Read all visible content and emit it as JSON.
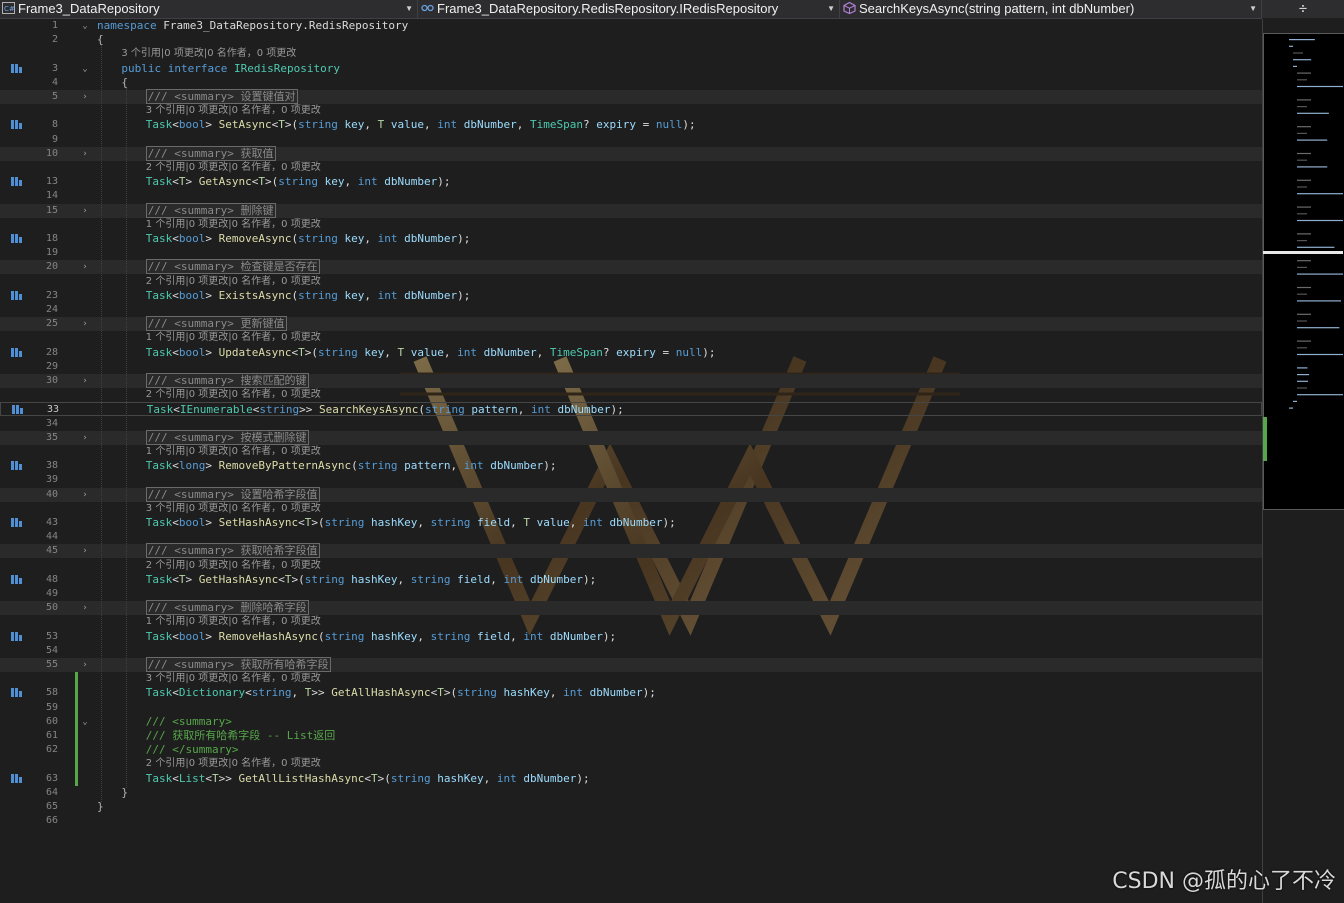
{
  "navbar": {
    "project": "Frame3_DataRepository",
    "type_path": "Frame3_DataRepository.RedisRepository.IRedisRepository",
    "member": "SearchKeysAsync(string pattern, int dbNumber)",
    "split_glyph": "÷"
  },
  "colors": {
    "keyword": "#569cd6",
    "type": "#4ec9b0",
    "method": "#dcdcaa",
    "parameter": "#9cdcfe",
    "comment": "#57a64a",
    "modified": "#57a64a"
  },
  "watermark_logo": "Wonder Woman W",
  "code": {
    "lines": [
      {
        "n": "1",
        "kind": "code",
        "fold": "⌄",
        "html": "<span class=\"kw\">namespace</span> Frame3_DataRepository.RedisRepository"
      },
      {
        "n": "2",
        "kind": "code",
        "html": "<span class=\"pu\">{</span>"
      },
      {
        "kind": "lens",
        "indent": 2,
        "text": "3 个引用|0 项更改|0 名作者，0 项更改"
      },
      {
        "n": "3",
        "kind": "code",
        "ref": true,
        "fold": "⌄",
        "indent": 2,
        "html": "<span class=\"kw\">public</span> <span class=\"kw\">interface</span> <span class=\"ty\">IRedisRepository</span>"
      },
      {
        "n": "4",
        "kind": "code",
        "indent": 2,
        "html": "<span class=\"pu\">{</span>"
      },
      {
        "n": "5",
        "kind": "summary",
        "fold": "›",
        "indent": 4,
        "text": "/// <summary> 设置键值对"
      },
      {
        "kind": "lens",
        "indent": 4,
        "text": "3 个引用|0 项更改|0 名作者，0 项更改"
      },
      {
        "n": "8",
        "kind": "code",
        "ref": true,
        "indent": 4,
        "html": "<span class=\"ty\">Task</span>&lt;<span class=\"kw\">bool</span>&gt; <span class=\"fn\">SetAsync</span>&lt;<span class=\"tp\">T</span>&gt;(<span class=\"kw\">string</span> <span class=\"pm\">key</span>, <span class=\"tp\">T</span> <span class=\"pm\">value</span>, <span class=\"kw\">int</span> <span class=\"pm\">dbNumber</span>, <span class=\"ty\">TimeSpan</span>? <span class=\"pm\">expiry</span> = <span class=\"kw\">null</span>);"
      },
      {
        "n": "9",
        "kind": "blank"
      },
      {
        "n": "10",
        "kind": "summary",
        "fold": "›",
        "indent": 4,
        "text": "/// <summary> 获取值"
      },
      {
        "kind": "lens",
        "indent": 4,
        "text": "2 个引用|0 项更改|0 名作者，0 项更改"
      },
      {
        "n": "13",
        "kind": "code",
        "ref": true,
        "indent": 4,
        "html": "<span class=\"ty\">Task</span>&lt;<span class=\"tp\">T</span>&gt; <span class=\"fn\">GetAsync</span>&lt;<span class=\"tp\">T</span>&gt;(<span class=\"kw\">string</span> <span class=\"pm\">key</span>, <span class=\"kw\">int</span> <span class=\"pm\">dbNumber</span>);"
      },
      {
        "n": "14",
        "kind": "blank"
      },
      {
        "n": "15",
        "kind": "summary",
        "fold": "›",
        "indent": 4,
        "text": "/// <summary> 删除键"
      },
      {
        "kind": "lens",
        "indent": 4,
        "text": "1 个引用|0 项更改|0 名作者，0 项更改"
      },
      {
        "n": "18",
        "kind": "code",
        "ref": true,
        "indent": 4,
        "html": "<span class=\"ty\">Task</span>&lt;<span class=\"kw\">bool</span>&gt; <span class=\"fn\">RemoveAsync</span>(<span class=\"kw\">string</span> <span class=\"pm\">key</span>, <span class=\"kw\">int</span> <span class=\"pm\">dbNumber</span>);"
      },
      {
        "n": "19",
        "kind": "blank"
      },
      {
        "n": "20",
        "kind": "summary",
        "fold": "›",
        "indent": 4,
        "text": "/// <summary> 检查键是否存在"
      },
      {
        "kind": "lens",
        "indent": 4,
        "text": "2 个引用|0 项更改|0 名作者，0 项更改"
      },
      {
        "n": "23",
        "kind": "code",
        "ref": true,
        "indent": 4,
        "html": "<span class=\"ty\">Task</span>&lt;<span class=\"kw\">bool</span>&gt; <span class=\"fn\">ExistsAsync</span>(<span class=\"kw\">string</span> <span class=\"pm\">key</span>, <span class=\"kw\">int</span> <span class=\"pm\">dbNumber</span>);"
      },
      {
        "n": "24",
        "kind": "blank"
      },
      {
        "n": "25",
        "kind": "summary",
        "fold": "›",
        "indent": 4,
        "text": "/// <summary> 更新键值"
      },
      {
        "kind": "lens",
        "indent": 4,
        "text": "1 个引用|0 项更改|0 名作者，0 项更改"
      },
      {
        "n": "28",
        "kind": "code",
        "ref": true,
        "indent": 4,
        "html": "<span class=\"ty\">Task</span>&lt;<span class=\"kw\">bool</span>&gt; <span class=\"fn\">UpdateAsync</span>&lt;<span class=\"tp\">T</span>&gt;(<span class=\"kw\">string</span> <span class=\"pm\">key</span>, <span class=\"tp\">T</span> <span class=\"pm\">value</span>, <span class=\"kw\">int</span> <span class=\"pm\">dbNumber</span>, <span class=\"ty\">TimeSpan</span>? <span class=\"pm\">expiry</span> = <span class=\"kw\">null</span>);"
      },
      {
        "n": "29",
        "kind": "blank"
      },
      {
        "n": "30",
        "kind": "summary",
        "fold": "›",
        "indent": 4,
        "text": "/// <summary> 搜索匹配的键"
      },
      {
        "kind": "lens",
        "indent": 4,
        "text": "2 个引用|0 项更改|0 名作者，0 项更改"
      },
      {
        "n": "33",
        "kind": "code",
        "ref": true,
        "current": true,
        "indent": 4,
        "html": "<span class=\"ty\">Task</span>&lt;<span class=\"ty\">IEnumerable</span>&lt;<span class=\"kw\">string</span>&gt;&gt; <span class=\"fn\">SearchKeysAsync</span>(<span class=\"kw\">string</span> <span class=\"pm\">pattern</span>, <span class=\"kw\">int</span> <span class=\"pm\">dbNumber</span>);"
      },
      {
        "n": "34",
        "kind": "blank"
      },
      {
        "n": "35",
        "kind": "summary",
        "fold": "›",
        "indent": 4,
        "text": "/// <summary> 按模式删除键"
      },
      {
        "kind": "lens",
        "indent": 4,
        "text": "1 个引用|0 项更改|0 名作者，0 项更改"
      },
      {
        "n": "38",
        "kind": "code",
        "ref": true,
        "indent": 4,
        "html": "<span class=\"ty\">Task</span>&lt;<span class=\"kw\">long</span>&gt; <span class=\"fn\">RemoveByPatternAsync</span>(<span class=\"kw\">string</span> <span class=\"pm\">pattern</span>, <span class=\"kw\">int</span> <span class=\"pm\">dbNumber</span>);"
      },
      {
        "n": "39",
        "kind": "blank"
      },
      {
        "n": "40",
        "kind": "summary",
        "fold": "›",
        "indent": 4,
        "text": "/// <summary> 设置哈希字段值"
      },
      {
        "kind": "lens",
        "indent": 4,
        "text": "3 个引用|0 项更改|0 名作者，0 项更改"
      },
      {
        "n": "43",
        "kind": "code",
        "ref": true,
        "indent": 4,
        "html": "<span class=\"ty\">Task</span>&lt;<span class=\"kw\">bool</span>&gt; <span class=\"fn\">SetHashAsync</span>&lt;<span class=\"tp\">T</span>&gt;(<span class=\"kw\">string</span> <span class=\"pm\">hashKey</span>, <span class=\"kw\">string</span> <span class=\"pm\">field</span>, <span class=\"tp\">T</span> <span class=\"pm\">value</span>, <span class=\"kw\">int</span> <span class=\"pm\">dbNumber</span>);"
      },
      {
        "n": "44",
        "kind": "blank"
      },
      {
        "n": "45",
        "kind": "summary",
        "fold": "›",
        "indent": 4,
        "text": "/// <summary> 获取哈希字段值"
      },
      {
        "kind": "lens",
        "indent": 4,
        "text": "2 个引用|0 项更改|0 名作者，0 项更改"
      },
      {
        "n": "48",
        "kind": "code",
        "ref": true,
        "indent": 4,
        "html": "<span class=\"ty\">Task</span>&lt;<span class=\"tp\">T</span>&gt; <span class=\"fn\">GetHashAsync</span>&lt;<span class=\"tp\">T</span>&gt;(<span class=\"kw\">string</span> <span class=\"pm\">hashKey</span>, <span class=\"kw\">string</span> <span class=\"pm\">field</span>, <span class=\"kw\">int</span> <span class=\"pm\">dbNumber</span>);"
      },
      {
        "n": "49",
        "kind": "blank"
      },
      {
        "n": "50",
        "kind": "summary",
        "fold": "›",
        "indent": 4,
        "text": "/// <summary> 删除哈希字段"
      },
      {
        "kind": "lens",
        "indent": 4,
        "text": "1 个引用|0 项更改|0 名作者，0 项更改"
      },
      {
        "n": "53",
        "kind": "code",
        "ref": true,
        "indent": 4,
        "html": "<span class=\"ty\">Task</span>&lt;<span class=\"kw\">bool</span>&gt; <span class=\"fn\">RemoveHashAsync</span>(<span class=\"kw\">string</span> <span class=\"pm\">hashKey</span>, <span class=\"kw\">string</span> <span class=\"pm\">field</span>, <span class=\"kw\">int</span> <span class=\"pm\">dbNumber</span>);"
      },
      {
        "n": "54",
        "kind": "blank"
      },
      {
        "n": "55",
        "kind": "summary",
        "fold": "›",
        "indent": 4,
        "text": "/// <summary> 获取所有哈希字段"
      },
      {
        "kind": "lens",
        "indent": 4,
        "text": "3 个引用|0 项更改|0 名作者，0 项更改",
        "mod": true
      },
      {
        "n": "58",
        "kind": "code",
        "ref": true,
        "mod": true,
        "indent": 4,
        "html": "<span class=\"ty\">Task</span>&lt;<span class=\"ty\">Dictionary</span>&lt;<span class=\"kw\">string</span>, <span class=\"tp\">T</span>&gt;&gt; <span class=\"fn\">GetAllHashAsync</span>&lt;<span class=\"tp\">T</span>&gt;(<span class=\"kw\">string</span> <span class=\"pm\">hashKey</span>, <span class=\"kw\">int</span> <span class=\"pm\">dbNumber</span>);"
      },
      {
        "n": "59",
        "kind": "blank",
        "mod": true
      },
      {
        "n": "60",
        "kind": "code",
        "fold": "⌄",
        "mod": true,
        "indent": 4,
        "html": "<span class=\"cm\">/// &lt;summary&gt;</span>"
      },
      {
        "n": "61",
        "kind": "code",
        "mod": true,
        "indent": 4,
        "html": "<span class=\"cm\">/// 获取所有哈希字段 -- List返回</span>"
      },
      {
        "n": "62",
        "kind": "code",
        "mod": true,
        "indent": 4,
        "html": "<span class=\"cm\">/// &lt;/summary&gt;</span>"
      },
      {
        "kind": "lens",
        "indent": 4,
        "text": "2 个引用|0 项更改|0 名作者，0 项更改",
        "mod": true
      },
      {
        "n": "63",
        "kind": "code",
        "ref": true,
        "mod": true,
        "indent": 4,
        "html": "<span class=\"ty\">Task</span>&lt;<span class=\"ty\">List</span>&lt;<span class=\"tp\">T</span>&gt;&gt; <span class=\"fn\">GetAllListHashAsync</span>&lt;<span class=\"tp\">T</span>&gt;(<span class=\"kw\">string</span> <span class=\"pm\">hashKey</span>, <span class=\"kw\">int</span> <span class=\"pm\">dbNumber</span>);"
      },
      {
        "n": "64",
        "kind": "code",
        "indent": 2,
        "html": "<span class=\"pu\">}</span>"
      },
      {
        "n": "65",
        "kind": "code",
        "html": "<span class=\"pu\">}</span>"
      },
      {
        "n": "66",
        "kind": "blank"
      }
    ]
  },
  "watermark": "CSDN @孤的心了不冷"
}
